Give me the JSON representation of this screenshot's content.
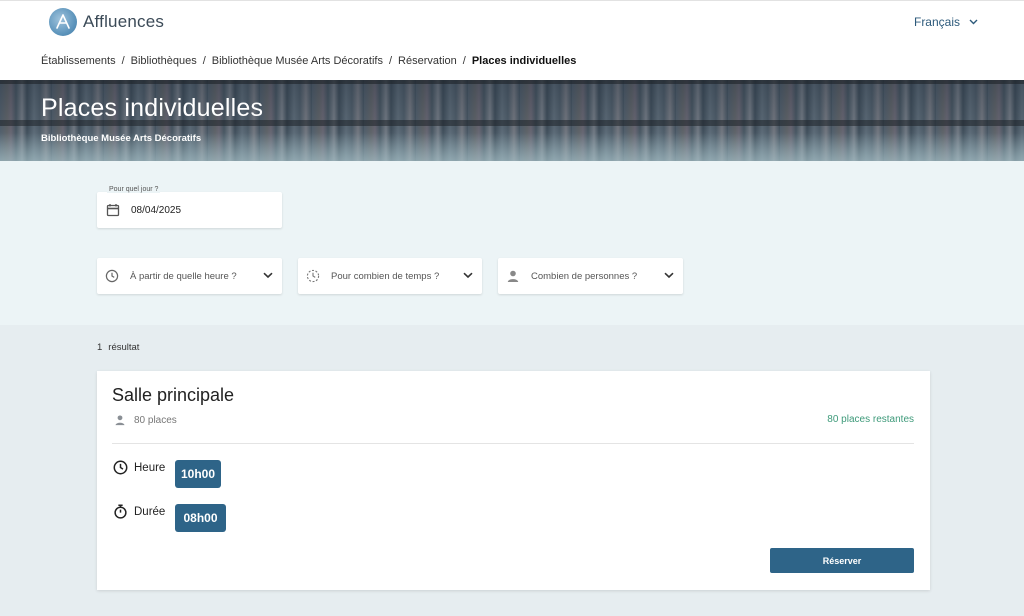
{
  "header": {
    "logo_text": "Affluences",
    "language": "Français"
  },
  "breadcrumb": [
    "Établissements",
    "Bibliothèques",
    "Bibliothèque Musée Arts Décoratifs",
    "Réservation",
    "Places individuelles"
  ],
  "hero": {
    "title": "Places individuelles",
    "subtitle": "Bibliothèque Musée Arts Décoratifs"
  },
  "filters": {
    "date_label": "Pour quel jour ?",
    "date_value": "08/04/2025",
    "time_placeholder": "À partir de quelle heure ?",
    "duration_placeholder": "Pour combien de temps ?",
    "people_placeholder": "Combien de personnes ?"
  },
  "results": {
    "count": "1",
    "count_label": "résultat"
  },
  "card": {
    "title": "Salle principale",
    "places": "80 places",
    "remaining": "80 places restantes",
    "time_label": "Heure",
    "time_value": "10h00",
    "duration_label": "Durée",
    "duration_value": "08h00",
    "reserve_label": "Réserver"
  },
  "colors": {
    "primary": "#2e6488",
    "available": "#3e9a7a",
    "filter_bg": "#ecf4f6",
    "results_bg": "#e6edf0"
  }
}
